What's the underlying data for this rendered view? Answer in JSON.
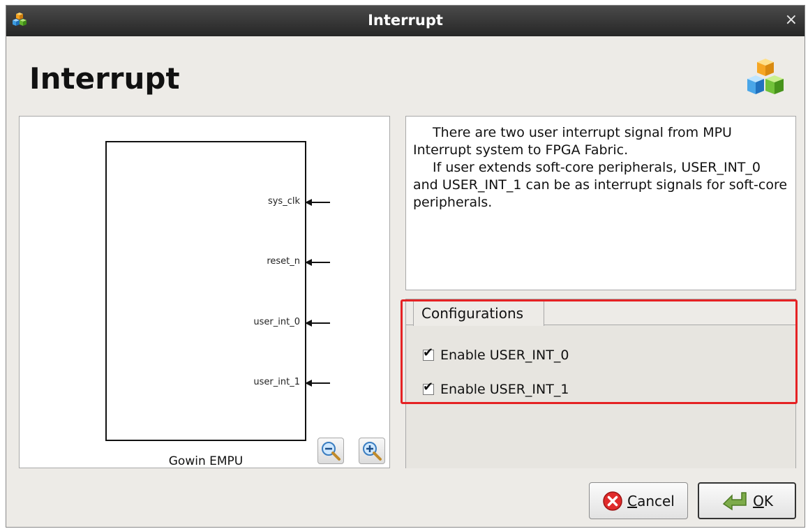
{
  "window": {
    "title": "Interrupt",
    "close_glyph": "×",
    "app_icon": "colored-cubes-icon"
  },
  "heading": "Interrupt",
  "header_icon": "colored-cubes-icon",
  "diagram": {
    "block_name": "Gowin EMPU",
    "ports": [
      "sys_clk",
      "reset_n",
      "user_int_0",
      "user_int_1"
    ],
    "zoom_out_icon": "zoom-out-icon",
    "zoom_in_icon": "zoom-in-icon"
  },
  "description": {
    "paragraph1": "There are two user interrupt signal from MPU Interrupt system to FPGA Fabric.",
    "paragraph2": "If user extends soft-core peripherals, USER_INT_0 and USER_INT_1 can be as interrupt signals for soft-core peripherals."
  },
  "config": {
    "tab_label": "Configurations",
    "options": [
      {
        "label": "Enable USER_INT_0",
        "checked": true
      },
      {
        "label": "Enable USER_INT_1",
        "checked": true
      }
    ],
    "check_glyph": "✔"
  },
  "buttons": {
    "cancel": {
      "mnemonic": "C",
      "rest": "ancel",
      "icon": "cancel-icon"
    },
    "ok": {
      "mnemonic": "O",
      "rest": "K",
      "icon": "ok-arrow-icon"
    }
  },
  "colors": {
    "highlight": "#e52224",
    "titlebar": "#2f2f2f",
    "window_bg": "#edebe7"
  }
}
